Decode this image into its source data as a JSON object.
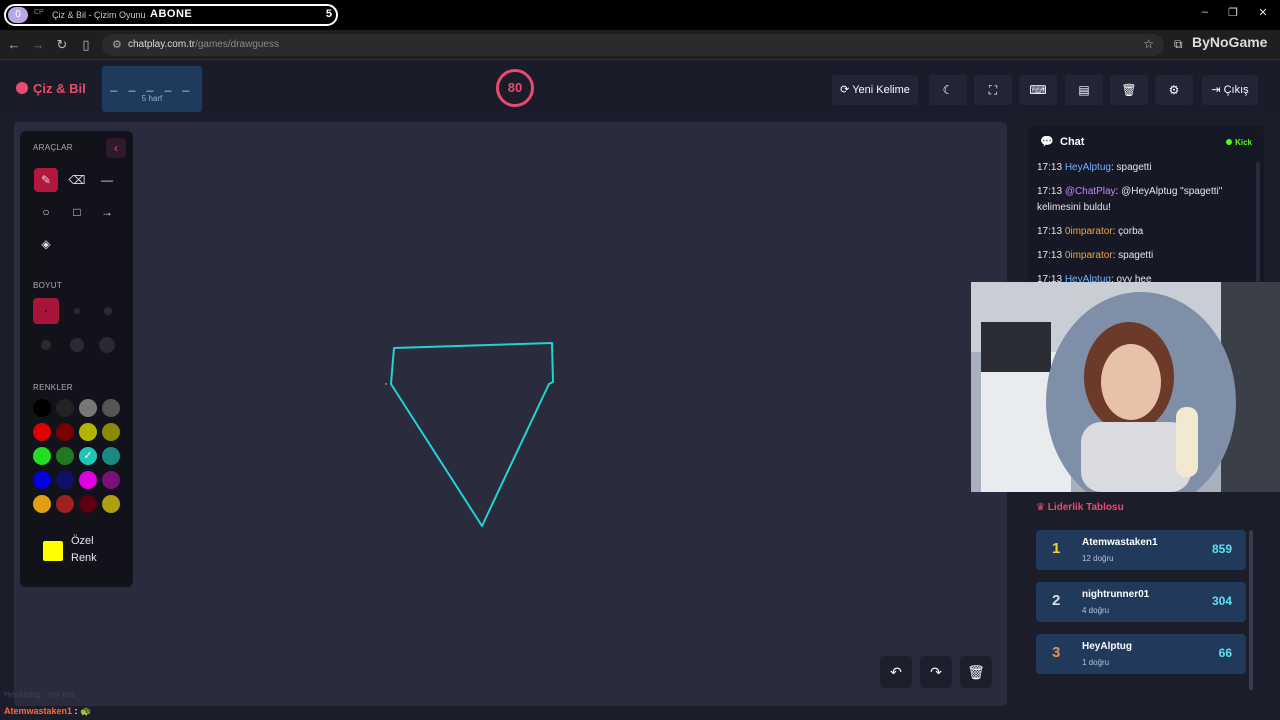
{
  "browser": {
    "tab_badge": "0",
    "tab_favicon": "CP",
    "tab_title": "Çiz & Bil - Çizim Oyunu",
    "overlay_subscribe": "ABONE",
    "overlay_count": "5",
    "url_host": "chatplay.com.tr",
    "url_path": "/games/drawguess",
    "extension_text": "ByNoGame"
  },
  "header": {
    "logo": "Çiz & Bil",
    "word_blanks": "_ _ _ _ _",
    "word_length": "5 harf",
    "timer": "80",
    "new_word_label": "Yeni Kelime",
    "exit_label": "Çıkış"
  },
  "tools": {
    "section_tools": "ARAÇLAR",
    "section_size": "BOYUT",
    "section_colors": "RENKLER",
    "custom_color_label_1": "Özel",
    "custom_color_label_2": "Renk",
    "custom_color": "#ffff00",
    "palette": [
      "#000000",
      "#222222",
      "#777777",
      "#555555",
      "#e00000",
      "#7a0000",
      "#b5b500",
      "#8a8a00",
      "#22dd22",
      "#1f7a1f",
      "#22c4b8",
      "#1a8a80",
      "#0000e0",
      "#10106a",
      "#e000e0",
      "#7a107a",
      "#e0a010",
      "#a02020",
      "#5a0010",
      "#b0a010"
    ],
    "selected_color": "#22c4b8"
  },
  "chat": {
    "title": "Chat",
    "platform": "Kick",
    "messages": [
      {
        "time": "17:13",
        "user": "HeyAlptug",
        "text": ": spagetti",
        "cls": "u-blue"
      },
      {
        "time": "17:13",
        "user": "@ChatPlay",
        "text": ": @HeyAlptug \"spagetti\" kelimesini buldu!",
        "cls": "u-purple"
      },
      {
        "time": "17:13",
        "user": "0imparator",
        "text": ": çorba",
        "cls": "u-orange"
      },
      {
        "time": "17:13",
        "user": "0imparator",
        "text": ": spagetti",
        "cls": "u-orange"
      },
      {
        "time": "17:13",
        "user": "HeyAlptug",
        "text": ": oyy hee",
        "cls": "u-blue"
      }
    ]
  },
  "leaderboard": {
    "title": "Liderlik Tablosu",
    "rows": [
      {
        "rank": "1",
        "name": "Atemwastaken1",
        "correct": "12 doğru",
        "score": "859",
        "rank_color": "#f5d33a"
      },
      {
        "rank": "2",
        "name": "nightrunner01",
        "correct": "4 doğru",
        "score": "304",
        "rank_color": "#d8dde6"
      },
      {
        "rank": "3",
        "name": "HeyAlptug",
        "correct": "1 doğru",
        "score": "66",
        "rank_color": "#e0944a"
      }
    ]
  },
  "overlay": {
    "line1": "HeyAlptug : oyy hee",
    "line2_user": "Atemwastaken1",
    "line2_sep": " :"
  },
  "drawing": {
    "stroke_color": "#22d3d0"
  }
}
